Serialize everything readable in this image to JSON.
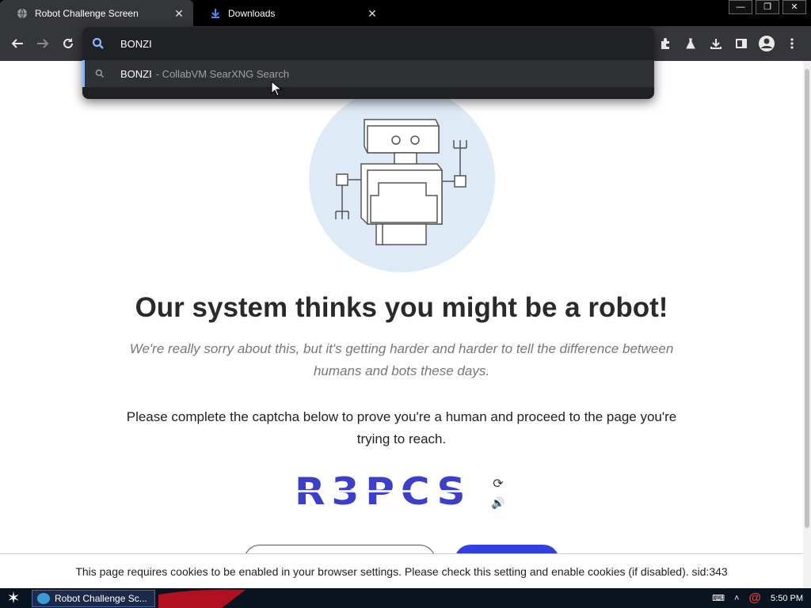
{
  "browser": {
    "tabs": [
      {
        "title": "Robot Challenge Screen",
        "icon": "globe-icon",
        "active": true
      },
      {
        "title": "Downloads",
        "icon": "download-icon",
        "active": false
      }
    ],
    "tab_close_glyph": "✕",
    "window_controls": {
      "minimize": "—",
      "restore": "❐",
      "close": "✕"
    },
    "omnibox": {
      "text": "BONZI",
      "suggestion_main": "BONZI",
      "suggestion_sub": "- CollabVM SearXNG Search"
    }
  },
  "page": {
    "headline": "Our system thinks you might be a robot!",
    "sorry": "We're really sorry about this, but it's getting harder and harder to tell the difference between humans and bots these days.",
    "instructions": "Please complete the captcha below to prove you're a human and proceed to the page you're trying to reach.",
    "captcha_text": "R3PCS",
    "captcha_refresh_glyph": "⟳",
    "captcha_audio_glyph": "🔊",
    "cookie_notice": "This page requires cookies to be enabled in your browser settings. Please check this setting and enable cookies (if disabled). sid:343"
  },
  "taskbar": {
    "start_glyph": "✶",
    "task_title": "Robot Challenge Sc...",
    "tray_keyboard": "⌨",
    "tray_caret": "˄",
    "tray_at": "@",
    "clock": "5:50 PM"
  },
  "colors": {
    "accent": "#8ab4f8",
    "captcha": "#3b3fcc",
    "submit": "#3340e0",
    "robot_circle": "#deebf7"
  }
}
